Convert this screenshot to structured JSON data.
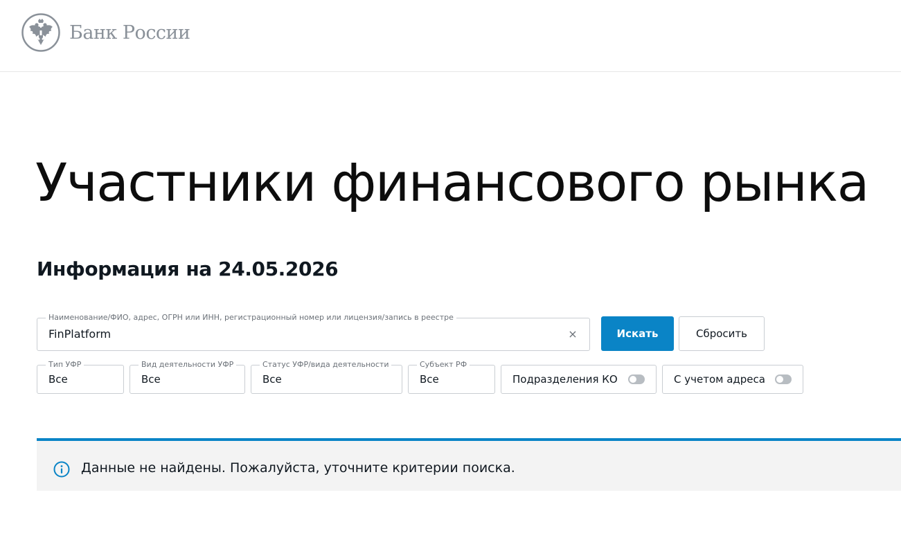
{
  "header": {
    "logo_text": "Банк России",
    "logo_icon": "double-headed-eagle-emblem-icon"
  },
  "page": {
    "title": "Участники финансового рынка",
    "info_date": "Информация на 24.05.2026"
  },
  "search": {
    "legend": "Наименование/ФИО, адрес, ОГРН или ИНН, регистрационный номер или лицензия/запись в реестре",
    "value": "FinPlatform",
    "clear_icon": "×",
    "search_button": "Искать",
    "reset_button": "Сбросить"
  },
  "filters": [
    {
      "legend": "Тип УФР",
      "value": "Все"
    },
    {
      "legend": "Вид деятельности УФР",
      "value": "Все"
    },
    {
      "legend": "Статус УФР/вида деятельности",
      "value": "Все"
    },
    {
      "legend": "Субъект РФ",
      "value": "Все"
    }
  ],
  "toggles": [
    {
      "label": "Подразделения КО",
      "on": false
    },
    {
      "label": "С учетом адреса",
      "on": false
    }
  ],
  "alert": {
    "icon": "info-icon",
    "text": "Данные не найдены. Пожалуйста, уточните критерии поиска."
  },
  "colors": {
    "accent": "#0a84c6",
    "logo_grey": "#8a9199",
    "border": "#c9cdd2",
    "alert_bg": "#f3f3f3"
  }
}
